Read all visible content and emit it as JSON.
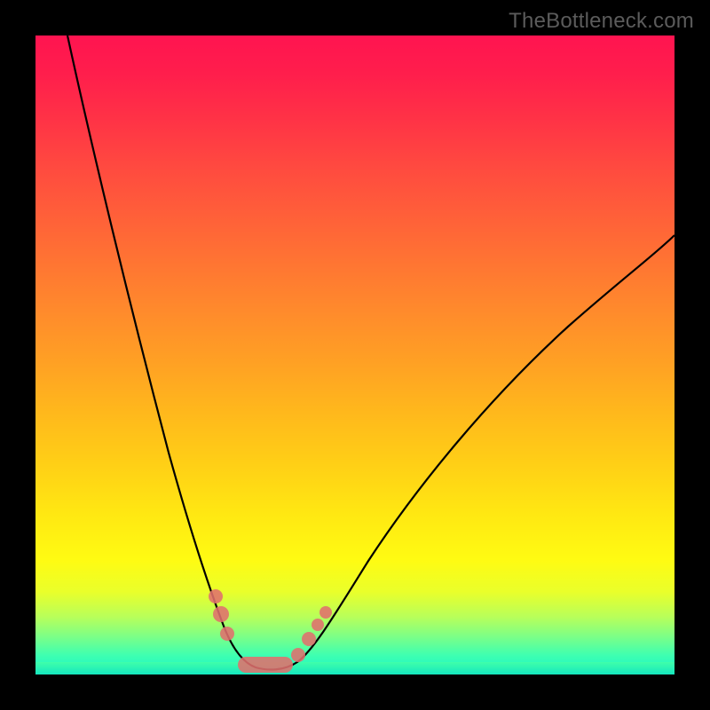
{
  "watermark": "TheBottleneck.com",
  "chart_data": {
    "type": "line",
    "title": "",
    "xlabel": "",
    "ylabel": "",
    "xlim": [
      0,
      100
    ],
    "ylim": [
      0,
      100
    ],
    "grid": false,
    "legend": false,
    "background_gradient": {
      "top": "#ff1450",
      "mid": "#ffe812",
      "bottom": "#18f5c8"
    },
    "series": [
      {
        "name": "bottleneck-curve",
        "color": "#000000",
        "x": [
          5,
          10,
          15,
          20,
          25,
          27,
          29,
          31,
          33,
          35,
          37,
          40,
          45,
          50,
          55,
          60,
          70,
          80,
          90,
          100
        ],
        "values": [
          100,
          78,
          58,
          40,
          22,
          15,
          9,
          5,
          2,
          1,
          1,
          2,
          8,
          15,
          22,
          29,
          41,
          52,
          61,
          69
        ]
      }
    ],
    "markers": [
      {
        "name": "left-beads",
        "x": [
          27.5,
          28.5,
          29.5
        ],
        "y": [
          13,
          10,
          7
        ]
      },
      {
        "name": "floor-beads",
        "x_range": [
          30,
          40
        ],
        "y": 1
      },
      {
        "name": "right-beads",
        "x": [
          41,
          42,
          43,
          44
        ],
        "y": [
          5,
          7,
          9,
          11
        ]
      }
    ],
    "colors": {
      "curve": "#000000",
      "markers": "#e06f6d",
      "frame": "#000000"
    }
  }
}
